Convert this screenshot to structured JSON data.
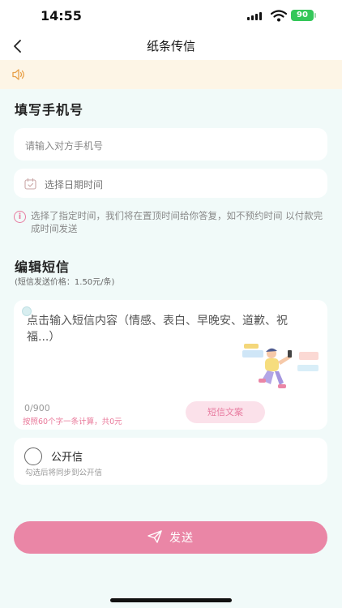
{
  "status_bar": {
    "time": "14:55",
    "battery": "90"
  },
  "nav": {
    "title": "纸条传信"
  },
  "phone_section": {
    "title": "填写手机号",
    "phone_placeholder": "请输入对方手机号",
    "date_placeholder": "选择日期时间",
    "notice": "选择了指定时间，我们将在置顶时间给你答复，如不预约时间 以付款完成时间发送"
  },
  "sms_section": {
    "title": "编辑短信",
    "price": "(短信发送价格：1.50元/条)",
    "placeholder": "点击输入短信内容（情感、表白、早晚安、道歉、祝福...）",
    "counter": "0/900",
    "billing_rule": "按照60个字一条计算，共0元",
    "template_button": "短信文案"
  },
  "public_letter": {
    "label": "公开信",
    "hint": "勾选后将同步到公开信"
  },
  "send_button": {
    "label": "发送"
  },
  "colors": {
    "accent": "#ea86a6",
    "background": "#f1faf9",
    "notice_bar": "#fdf5e6"
  },
  "icons": [
    "back-icon",
    "speaker-icon",
    "calendar-icon",
    "info-icon",
    "send-icon"
  ]
}
